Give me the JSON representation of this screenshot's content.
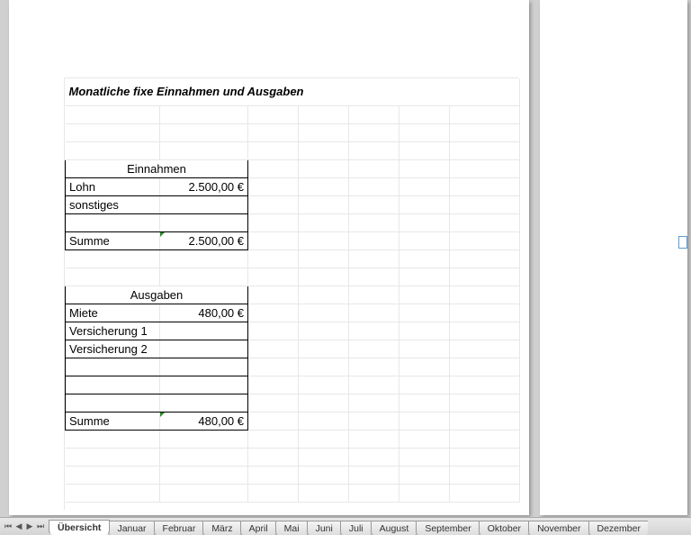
{
  "title": "Monatliche fixe Einnahmen und Ausgaben",
  "income": {
    "header": "Einnahmen",
    "rows": [
      {
        "label": "Lohn",
        "value": "2.500,00 €"
      },
      {
        "label": "sonstiges",
        "value": ""
      }
    ],
    "sum_label": "Summe",
    "sum_value": "2.500,00 €"
  },
  "expenses": {
    "header": "Ausgaben",
    "rows": [
      {
        "label": "Miete",
        "value": "480,00 €"
      },
      {
        "label": "Versicherung 1",
        "value": ""
      },
      {
        "label": "Versicherung 2",
        "value": ""
      }
    ],
    "sum_label": "Summe",
    "sum_value": "480,00 €"
  },
  "tabs": {
    "active": "Übersicht",
    "items": [
      "Übersicht",
      "Januar",
      "Februar",
      "März",
      "April",
      "Mai",
      "Juni",
      "Juli",
      "August",
      "September",
      "Oktober",
      "November",
      "Dezember"
    ]
  }
}
